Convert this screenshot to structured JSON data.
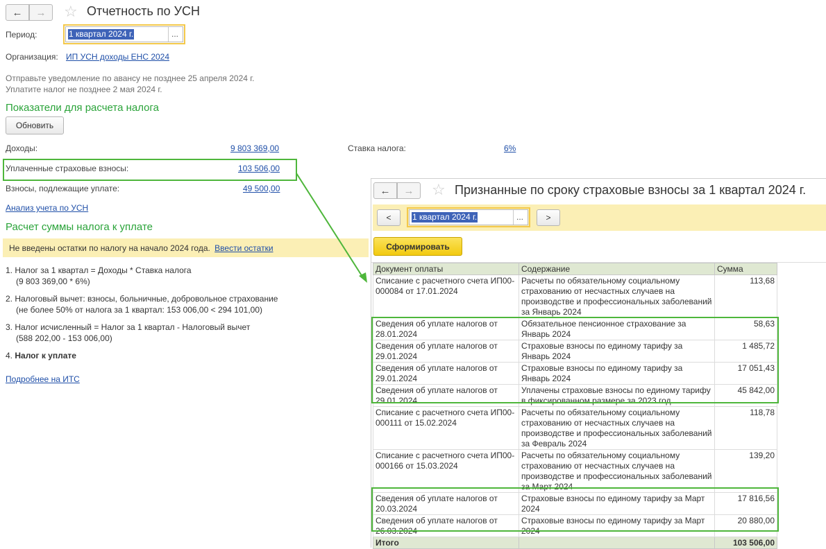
{
  "left": {
    "title": "Отчетность по УСН",
    "period_label": "Период:",
    "period_value": "1 квартал 2024 г.",
    "period_dots": "...",
    "org_label": "Организация:",
    "org_value": "ИП УСН доходы ЕНС 2024",
    "notice_1": "Отправьте уведомление по авансу не позднее 25 апреля 2024 г.",
    "notice_2": "Уплатите налог не позднее 2 мая 2024 г.",
    "section_indicators": "Показатели для расчета налога",
    "refresh_button": "Обновить",
    "income_label": "Доходы:",
    "income_value": "9 803 369,00",
    "rate_label": "Ставка налога:",
    "rate_value": "6%",
    "paid_label": "Уплаченные страховые взносы:",
    "paid_value": "103 506,00",
    "due_label": "Взносы, подлежащие уплате:",
    "due_value": "49 500,00",
    "analysis_link": "Анализ учета по УСН",
    "section_calc": "Расчет суммы налога к уплате",
    "warning_text": "Не введены остатки по налогу на начало 2024 года.",
    "warning_link": "Ввести остатки",
    "calc_items": [
      {
        "line1": "1. Налог за 1 квартал = Доходы * Ставка налога",
        "line2": "(9 803 369,00 * 6%)"
      },
      {
        "line1": "2. Налоговый вычет: взносы, больничные, добровольное страхование",
        "line2": "(не более 50% от налога за 1 квартал: 153 006,00 < 294 101,00)"
      },
      {
        "line1": "3. Налог исчисленный = Налог за 1 квартал - Налоговый вычет",
        "line2": "(588 202,00 - 153 006,00)"
      }
    ],
    "calc_item_4_num": "4.",
    "calc_item_4_text": "Налог к уплате",
    "more_link": "Подробнее на ИТС"
  },
  "right": {
    "title": "Признанные по сроку страховые взносы за 1 квартал 2024 г.",
    "prev_button": "<",
    "next_button": ">",
    "period_value": "1 квартал 2024 г.",
    "period_dots": "...",
    "generate_button": "Сформировать",
    "columns": [
      "Документ оплаты",
      "Содержание",
      "Сумма"
    ],
    "rows": [
      {
        "doc": "Списание с расчетного счета ИП00-000084 от 17.01.2024",
        "content": "Расчеты по обязательному социальному страхованию от несчастных случаев на производстве и профессиональных заболеваний за Январь 2024",
        "sum": "113,68"
      },
      {
        "doc": "Сведения об уплате налогов  от 28.01.2024",
        "content": "Обязательное пенсионное страхование за Январь 2024",
        "sum": "58,63"
      },
      {
        "doc": "Сведения об уплате налогов  от 29.01.2024",
        "content": "Страховые взносы по единому тарифу за Январь 2024",
        "sum": "1 485,72"
      },
      {
        "doc": "Сведения об уплате налогов  от 29.01.2024",
        "content": "Страховые взносы по единому тарифу за Январь 2024",
        "sum": "17 051,43"
      },
      {
        "doc": "Сведения об уплате налогов  от 29.01.2024",
        "content": "Уплачены страховые взносы по единому тарифу в фиксированном размере за 2023 год.",
        "sum": "45 842,00"
      },
      {
        "doc": "Списание с расчетного счета ИП00-000111 от 15.02.2024",
        "content": "Расчеты по обязательному социальному страхованию от несчастных случаев на производстве и профессиональных заболеваний за Февраль 2024",
        "sum": "118,78"
      },
      {
        "doc": "Списание с расчетного счета ИП00-000166 от 15.03.2024",
        "content": "Расчеты по обязательному социальному страхованию от несчастных случаев на производстве и профессиональных заболеваний за Март 2024",
        "sum": "139,20"
      },
      {
        "doc": "Сведения об уплате налогов  от 20.03.2024",
        "content": "Страховые взносы по единому тарифу за Март 2024",
        "sum": "17 816,56"
      },
      {
        "doc": "Сведения об уплате налогов  от 26.03.2024",
        "content": "Страховые взносы по единому тарифу за Март 2024",
        "sum": "20 880,00"
      }
    ],
    "total_label": "Итого",
    "total_value": "103 506,00"
  },
  "colors": {
    "highlight_green": "#4eb63b",
    "heading_green": "#2aa339",
    "link_blue": "#1f4fa8",
    "warning_yellow": "#fbefb5",
    "button_yellow": "#f6d21a"
  }
}
